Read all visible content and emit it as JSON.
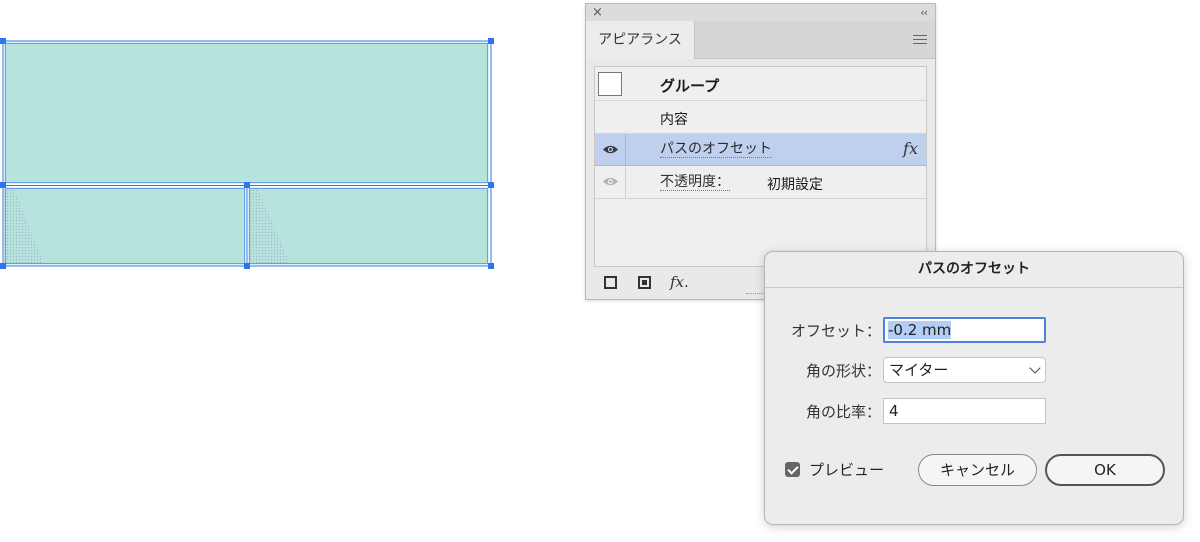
{
  "canvas": {
    "fill_color": "#b7e3df",
    "selection_color": "#2f73f1"
  },
  "panel": {
    "close_glyph": "×",
    "collapse_glyph": "‹‹",
    "tab_label": "アピアランス",
    "rows": {
      "group_label": "グループ",
      "contents_label": "内容",
      "offset_label": "パスのオフセット",
      "fx_glyph": "fx",
      "opacity_label": "不透明度：",
      "opacity_value": "初期設定"
    },
    "bottom": {
      "fx_glyph": "fx."
    },
    "selected_row_color": "#bfd0ef"
  },
  "dialog": {
    "title": "パスのオフセット",
    "offset_label": "オフセット：",
    "offset_value": "-0.2 mm",
    "join_label": "角の形状：",
    "join_value": "マイター",
    "miter_label": "角の比率：",
    "miter_value": "4",
    "preview_label": "プレビュー",
    "preview_checked": true,
    "cancel_label": "キャンセル",
    "ok_label": "OK"
  }
}
